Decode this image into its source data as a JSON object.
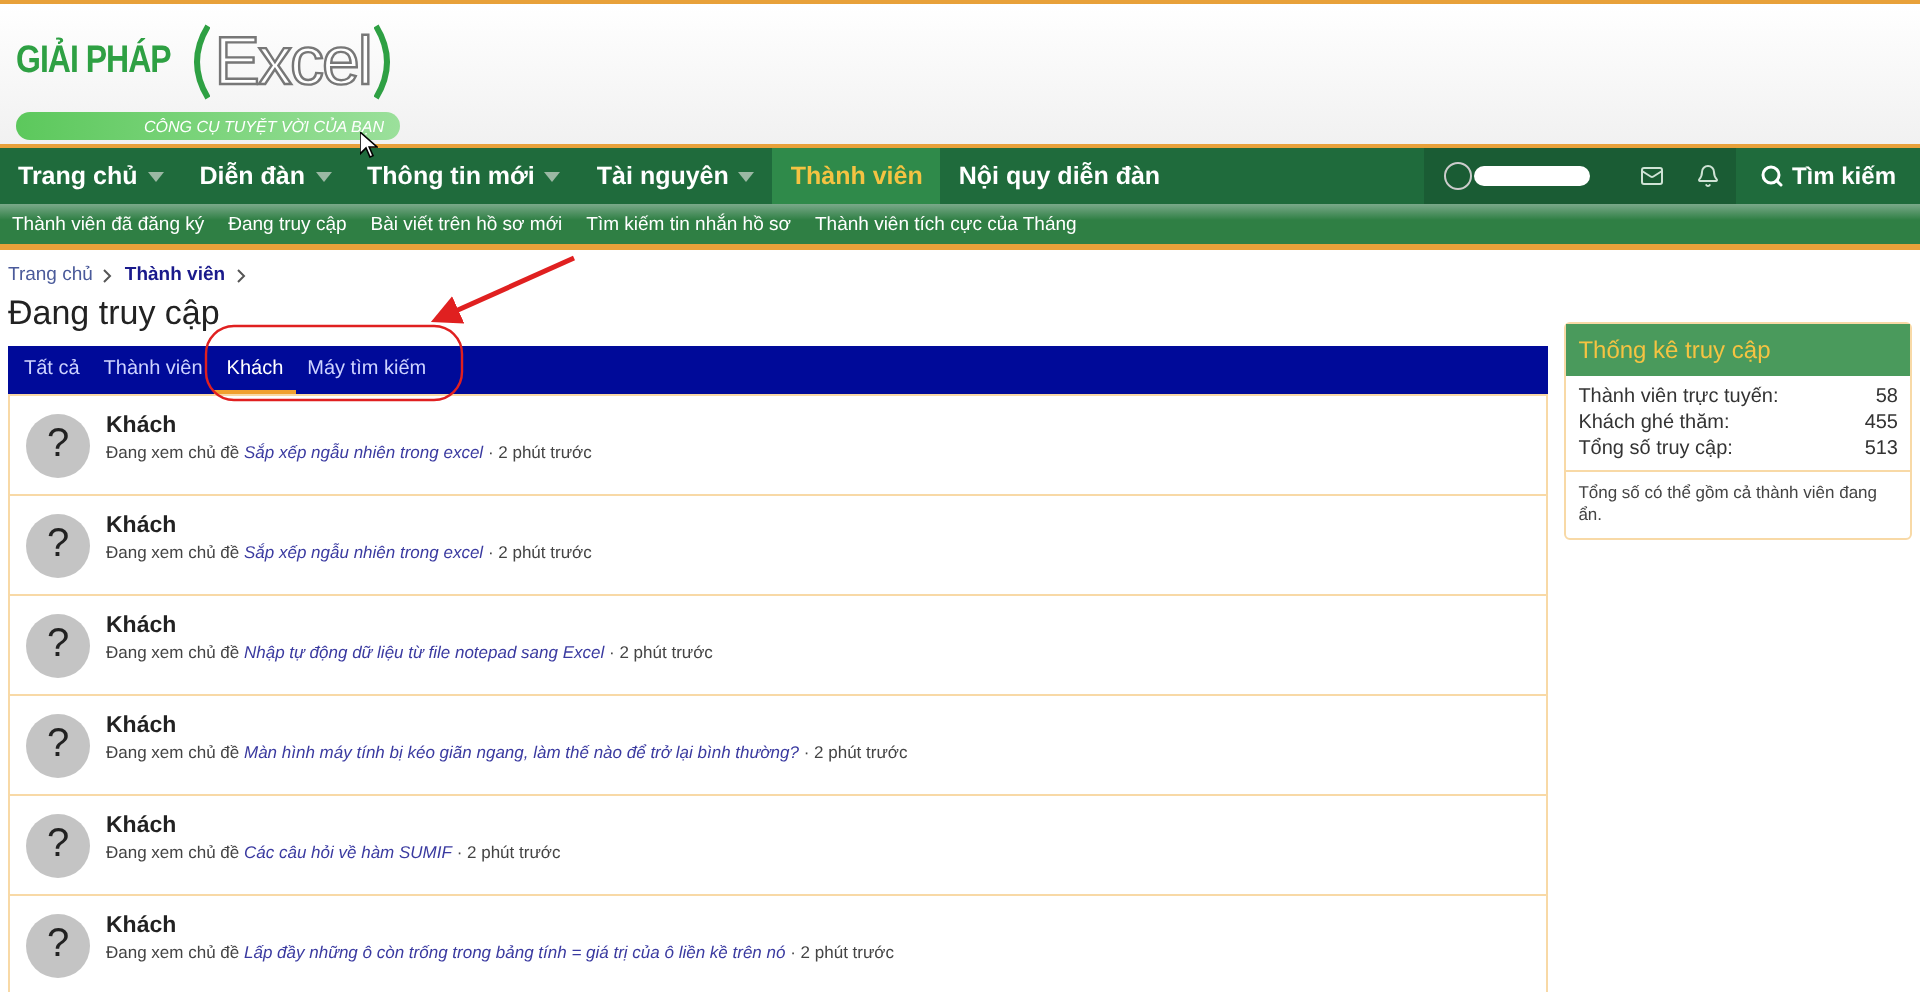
{
  "logo": {
    "brand": "GIẢI PHÁP",
    "wordmark": "Excel",
    "tagline": "CÔNG CỤ TUYỆT VỜI CỦA BẠN"
  },
  "nav": {
    "items": [
      {
        "label": "Trang chủ",
        "dropdown": true,
        "selected": false
      },
      {
        "label": "Diễn đàn",
        "dropdown": true,
        "selected": false
      },
      {
        "label": "Thông tin mới",
        "dropdown": true,
        "selected": false
      },
      {
        "label": "Tài nguyên",
        "dropdown": true,
        "selected": false
      },
      {
        "label": "Thành viên",
        "dropdown": false,
        "selected": true
      },
      {
        "label": "Nội quy diễn đàn",
        "dropdown": false,
        "selected": false
      }
    ],
    "search": "Tìm kiếm"
  },
  "subnav": [
    "Thành viên đã đăng ký",
    "Đang truy cập",
    "Bài viết trên hồ sơ mới",
    "Tìm kiếm tin nhắn hồ sơ",
    "Thành viên tích cực của Tháng"
  ],
  "breadcrumb": [
    {
      "label": "Trang chủ",
      "current": false
    },
    {
      "label": "Thành viên",
      "current": true
    }
  ],
  "title": "Đang truy cập",
  "tabs": [
    {
      "label": "Tất cả",
      "selected": false
    },
    {
      "label": "Thành viên",
      "selected": false
    },
    {
      "label": "Khách",
      "selected": true
    },
    {
      "label": "Máy tìm kiếm",
      "selected": false
    }
  ],
  "rows": [
    {
      "avatar": "?",
      "name": "Khách",
      "action": "Đang xem chủ đề",
      "topic": "Sắp xếp ngẫu nhiên trong excel",
      "time": "· 2 phút trước"
    },
    {
      "avatar": "?",
      "name": "Khách",
      "action": "Đang xem chủ đề",
      "topic": "Sắp xếp ngẫu nhiên trong excel",
      "time": "· 2 phút trước"
    },
    {
      "avatar": "?",
      "name": "Khách",
      "action": "Đang xem chủ đề",
      "topic": "Nhập tự động dữ liệu từ file notepad sang Excel",
      "time": "· 2 phút trước"
    },
    {
      "avatar": "?",
      "name": "Khách",
      "action": "Đang xem chủ đề",
      "topic": "Màn hình máy tính bị kéo giãn ngang, làm thế nào để trở lại bình thường?",
      "time": "· 2 phút trước"
    },
    {
      "avatar": "?",
      "name": "Khách",
      "action": "Đang xem chủ đề",
      "topic": "Các câu hỏi về hàm SUMIF",
      "time": "· 2 phút trước"
    },
    {
      "avatar": "?",
      "name": "Khách",
      "action": "Đang xem chủ đề",
      "topic": "Lấp đầy những ô còn trống trong bảng tính = giá trị của ô liền kề trên nó",
      "time": "· 2 phút trước"
    }
  ],
  "stats": {
    "title": "Thống kê truy cập",
    "items": [
      {
        "label": "Thành viên trực tuyến:",
        "value": "58"
      },
      {
        "label": "Khách ghé thăm:",
        "value": "455"
      },
      {
        "label": "Tổng số truy cập:",
        "value": "513"
      }
    ],
    "note": "Tổng số có thể gồm cả thành viên đang ẩn."
  }
}
